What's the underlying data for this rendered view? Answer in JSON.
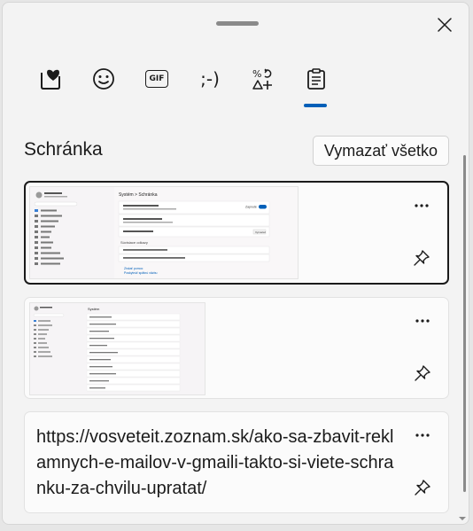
{
  "panel": {
    "section_title": "Schránka",
    "clear_all_label": "Vymazať všetko"
  },
  "tabs": [
    {
      "name": "favorites",
      "icon": "heart-icon"
    },
    {
      "name": "emoji",
      "icon": "smiley-icon"
    },
    {
      "name": "gif",
      "label": "GIF",
      "icon": "gif-icon"
    },
    {
      "name": "kaomoji",
      "label": ";-)",
      "icon": "kaomoji-icon"
    },
    {
      "name": "symbols",
      "icon": "symbols-icon"
    },
    {
      "name": "clipboard",
      "icon": "clipboard-icon",
      "selected": true
    }
  ],
  "thumb1": {
    "breadcrumb": "Systém  >  Schránka",
    "toggle_label": "Zapnuté",
    "button_label": "Vymazať",
    "related": "Súvisiace odkazy",
    "help": "Získať pomoc",
    "feedback": "Poskytnúť spätnú väzbu"
  },
  "thumb2": {
    "heading": "Systém"
  },
  "clipboard_items": [
    {
      "type": "image",
      "selected": true
    },
    {
      "type": "image",
      "selected": false
    },
    {
      "type": "text",
      "text": "https://vosveteit.zoznam.sk/ako-sa-zbavit-reklamnych-e-mailov-v-gmaili-takto-si-viete-schranku-za-chvilu-upratat/"
    }
  ],
  "colors": {
    "accent": "#005fb8",
    "text": "#1b1b1b",
    "background": "#f3f3f3",
    "card": "#fbfbfb"
  }
}
